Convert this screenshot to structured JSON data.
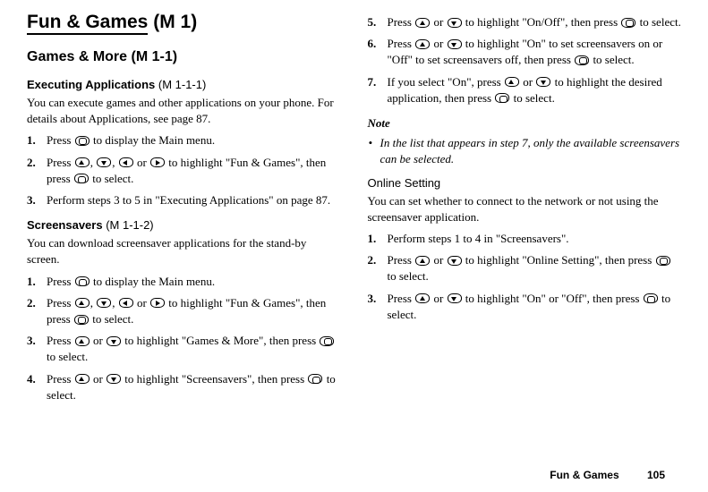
{
  "h1": {
    "title": "Fun & Games",
    "suffix": " (M 1)"
  },
  "h2": {
    "title": "Games & More",
    "suffix": " (M 1-1)"
  },
  "sec1": {
    "heading": "Executing Applications",
    "suffix": " (M 1-1-1)",
    "intro": "You can execute games and other applications on your phone. For details about Applications, see page 87.",
    "s1a": "Press ",
    "s1b": " to display the Main menu.",
    "s2a": "Press ",
    "s2b": ", ",
    "s2c": ", ",
    "s2d": " or ",
    "s2e": " to highlight \"Fun & Games\", then press ",
    "s2f": " to select.",
    "s3": "Perform steps 3 to 5 in \"Executing Applications\" on page 87."
  },
  "sec2": {
    "heading": "Screensavers",
    "suffix": " (M 1-1-2)",
    "intro": "You can download screensaver applications for the stand-by screen.",
    "s1a": "Press ",
    "s1b": " to display the Main menu.",
    "s2a": "Press ",
    "s2b": ", ",
    "s2c": ", ",
    "s2d": " or ",
    "s2e": " to highlight \"Fun & Games\", then press ",
    "s2f": " to select.",
    "s3a": "Press ",
    "s3b": " or ",
    "s3c": " to highlight \"Games & More\", then press ",
    "s3d": " to select.",
    "s4a": "Press ",
    "s4b": " or ",
    "s4c": " to highlight \"Screensavers\", then press ",
    "s4d": " to select.",
    "s5a": "Press ",
    "s5b": " or ",
    "s5c": " to highlight \"On/Off\", then press ",
    "s5d": " to select.",
    "s6a": "Press ",
    "s6b": " or ",
    "s6c": " to highlight \"On\" to set screensavers on or \"Off\" to set screensavers off, then press ",
    "s6d": " to select.",
    "s7a": "If you select \"On\", press ",
    "s7b": " or ",
    "s7c": " to highlight the desired application, then press ",
    "s7d": " to select."
  },
  "note": {
    "head": "Note",
    "body": "In the list that appears in step 7, only the available screensavers can be selected."
  },
  "sec3": {
    "heading": "Online Setting",
    "intro": "You can set whether to connect to the network or not using the screensaver application.",
    "s1": "Perform steps 1 to 4 in \"Screensavers\".",
    "s2a": "Press ",
    "s2b": " or ",
    "s2c": " to highlight \"Online Setting\", then press ",
    "s2d": " to select.",
    "s3a": "Press ",
    "s3b": " or ",
    "s3c": " to highlight \"On\" or \"Off\", then press ",
    "s3d": " to select."
  },
  "footer": {
    "section": "Fun & Games",
    "page": "105"
  }
}
